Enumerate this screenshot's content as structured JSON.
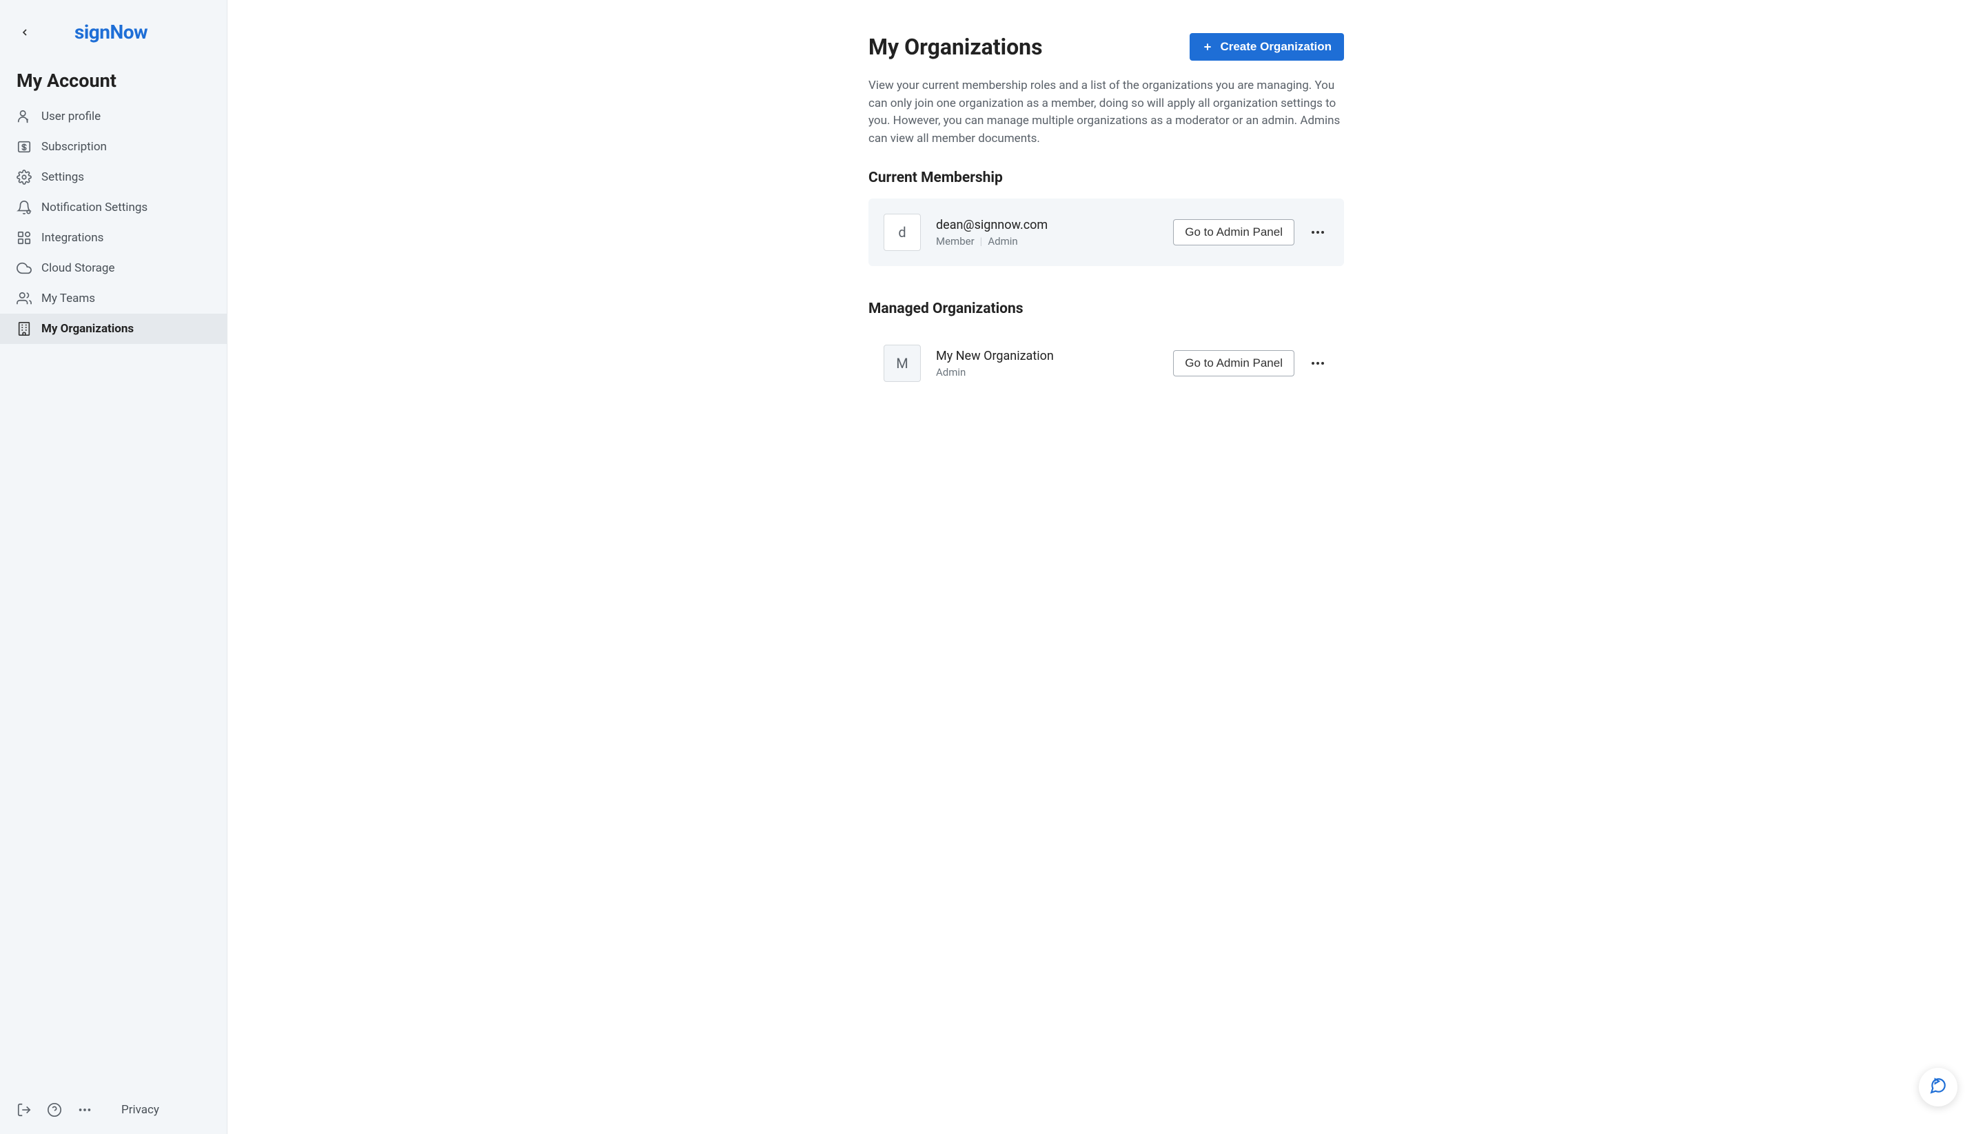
{
  "logo": "signNow",
  "sidebar": {
    "title": "My Account",
    "items": [
      {
        "label": "User profile"
      },
      {
        "label": "Subscription"
      },
      {
        "label": "Settings"
      },
      {
        "label": "Notification Settings"
      },
      {
        "label": "Integrations"
      },
      {
        "label": "Cloud Storage"
      },
      {
        "label": "My Teams"
      },
      {
        "label": "My Organizations"
      }
    ],
    "footer": {
      "privacy": "Privacy"
    }
  },
  "main": {
    "title": "My Organizations",
    "create_button": "Create Organization",
    "description": "View your current membership roles and a list of the organizations you are managing. You can only join one organization as a member, doing so will apply all organization settings to you. However, you can manage multiple organizations as a moderator or an admin. Admins can view all member documents.",
    "current_membership": {
      "title": "Current Membership",
      "avatar_letter": "d",
      "email": "dean@signnow.com",
      "role1": "Member",
      "role2": "Admin",
      "admin_panel_btn": "Go to Admin Panel"
    },
    "managed_orgs": {
      "title": "Managed Organizations",
      "items": [
        {
          "avatar_letter": "M",
          "name": "My New Organization",
          "role": "Admin",
          "admin_panel_btn": "Go to Admin Panel"
        }
      ]
    }
  }
}
